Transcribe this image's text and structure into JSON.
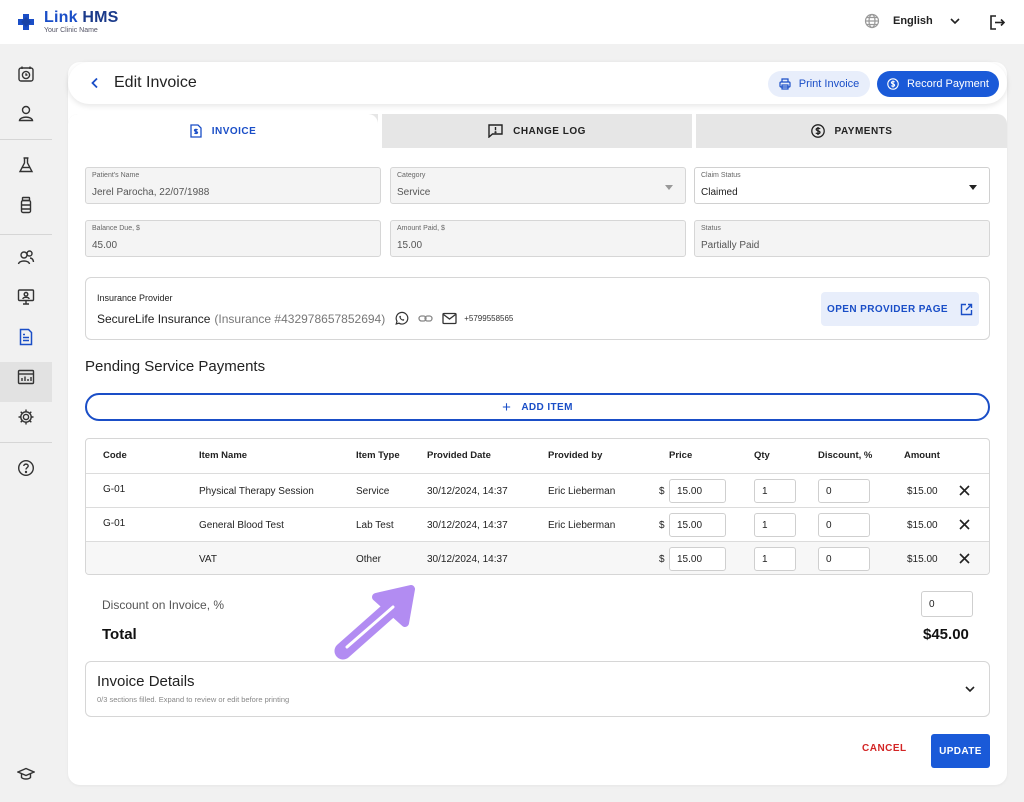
{
  "app": {
    "name_part1": "Link",
    "name_part2": "HMS",
    "subtitle": "Your Clinic Name",
    "brand_color": "#1a4ec7"
  },
  "topbar": {
    "language": "English",
    "icons": [
      "globe-icon",
      "chevron-down-icon",
      "logout-icon"
    ]
  },
  "sidebar": {
    "items": [
      {
        "name": "appointments",
        "icon": "clock-icon"
      },
      {
        "name": "patients",
        "icon": "user-icon"
      },
      {
        "name": "laboratory",
        "icon": "flask-icon"
      },
      {
        "name": "pharmacy",
        "icon": "bottle-icon"
      },
      {
        "name": "staff",
        "icon": "users-icon"
      },
      {
        "name": "telemedicine",
        "icon": "monitor-icon"
      },
      {
        "name": "billing",
        "icon": "invoice-icon",
        "active": true
      },
      {
        "name": "reports",
        "icon": "chart-icon"
      },
      {
        "name": "settings",
        "icon": "gear-icon"
      },
      {
        "name": "help",
        "icon": "help-icon"
      },
      {
        "name": "academy",
        "icon": "graduation-cap-icon"
      }
    ]
  },
  "header": {
    "title": "Edit Invoice",
    "print_label": "Print Invoice",
    "record_label": "Record Payment"
  },
  "tabs": [
    {
      "label": "INVOICE",
      "active": true
    },
    {
      "label": "CHANGE LOG",
      "active": false
    },
    {
      "label": "PAYMENTS",
      "active": false
    }
  ],
  "form": {
    "patient": {
      "label": "Patient's Name",
      "value": "Jerel Parocha, 22/07/1988"
    },
    "category": {
      "label": "Category",
      "value": "Service"
    },
    "claim_status": {
      "label": "Claim Status",
      "value": "Claimed"
    },
    "balance_due": {
      "label": "Balance Due, $",
      "value": "45.00"
    },
    "amount_paid": {
      "label": "Amount Paid, $",
      "value": "15.00"
    },
    "status": {
      "label": "Status",
      "value": "Partially Paid"
    }
  },
  "insurance": {
    "label": "Insurance Provider",
    "name": "SecureLife Insurance",
    "number": "(Insurance #432978657852694)",
    "phone": "+5799558565",
    "open_label": "OPEN PROVIDER PAGE"
  },
  "pending": {
    "title": "Pending Service Payments",
    "add_label": "ADD ITEM",
    "columns": [
      "Code",
      "Item Name",
      "Item Type",
      "Provided Date",
      "Provided by",
      "Price",
      "Qty",
      "Discount, %",
      "Amount"
    ],
    "rows": [
      {
        "code": "G-01",
        "name": "Physical Therapy Session",
        "type": "Service",
        "date": "30/12/2024, 14:37",
        "by": "Eric Lieberman",
        "currency": "$",
        "price": "15.00",
        "qty": "1",
        "discount": "0",
        "amount": "$15.00"
      },
      {
        "code": "G-01",
        "name": "General Blood Test",
        "type": "Lab Test",
        "date": "30/12/2024, 14:37",
        "by": "Eric Lieberman",
        "currency": "$",
        "price": "15.00",
        "qty": "1",
        "discount": "0",
        "amount": "$15.00"
      },
      {
        "code": "",
        "name": "VAT",
        "type": "Other",
        "date": "30/12/2024, 14:37",
        "by": "",
        "currency": "$",
        "price": "15.00",
        "qty": "1",
        "discount": "0",
        "amount": "$15.00"
      }
    ]
  },
  "totals": {
    "discount_label": "Discount on Invoice, %",
    "discount_value": "0",
    "total_label": "Total",
    "total_value": "$45.00"
  },
  "details": {
    "title": "Invoice Details",
    "subtitle": "0/3 sections filled. Expand to review or edit before printing"
  },
  "actions": {
    "cancel_label": "CANCEL",
    "update_label": "UPDATE"
  },
  "annotation": {
    "arrow_color": "#b28cf2"
  }
}
